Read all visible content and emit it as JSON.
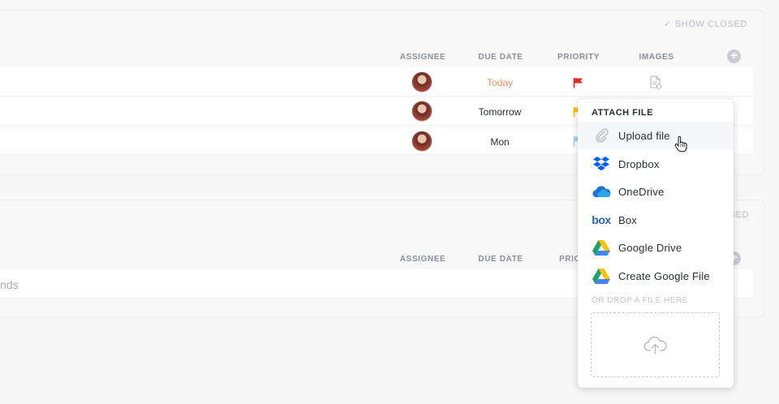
{
  "lists": [
    {
      "show_closed": "SHOW CLOSED",
      "columns": {
        "assignee": "ASSIGNEE",
        "due_date": "DUE DATE",
        "priority": "PRIORITY",
        "images": "IMAGES"
      },
      "rows": [
        {
          "due": "Today",
          "priority_color": "#e8291c"
        },
        {
          "due": "Tomorrow",
          "priority_color": "#ffc400"
        },
        {
          "due": "Mon",
          "priority_color": "#9fd3f5"
        }
      ]
    },
    {
      "show_closed": "SED",
      "columns": {
        "assignee": "ASSIGNEE",
        "due_date": "DUE DATE",
        "priority": "PRIO"
      },
      "rows": [
        {
          "title_fragment": "nds"
        }
      ]
    }
  ],
  "attach_menu": {
    "title": "ATTACH FILE",
    "items": [
      {
        "label": "Upload file",
        "icon": "paperclip-icon"
      },
      {
        "label": "Dropbox",
        "icon": "dropbox-icon"
      },
      {
        "label": "OneDrive",
        "icon": "onedrive-icon"
      },
      {
        "label": "Box",
        "icon": "box-icon"
      },
      {
        "label": "Google Drive",
        "icon": "google-drive-icon"
      },
      {
        "label": "Create Google File",
        "icon": "google-drive-icon"
      }
    ],
    "drop_label": "OR DROP A FILE HERE",
    "box_logo_text": "box"
  },
  "colors": {
    "today": "#f0915e",
    "dropbox": "#0061ff",
    "onedrive": "#1976d2",
    "box": "#2c5fb3"
  }
}
